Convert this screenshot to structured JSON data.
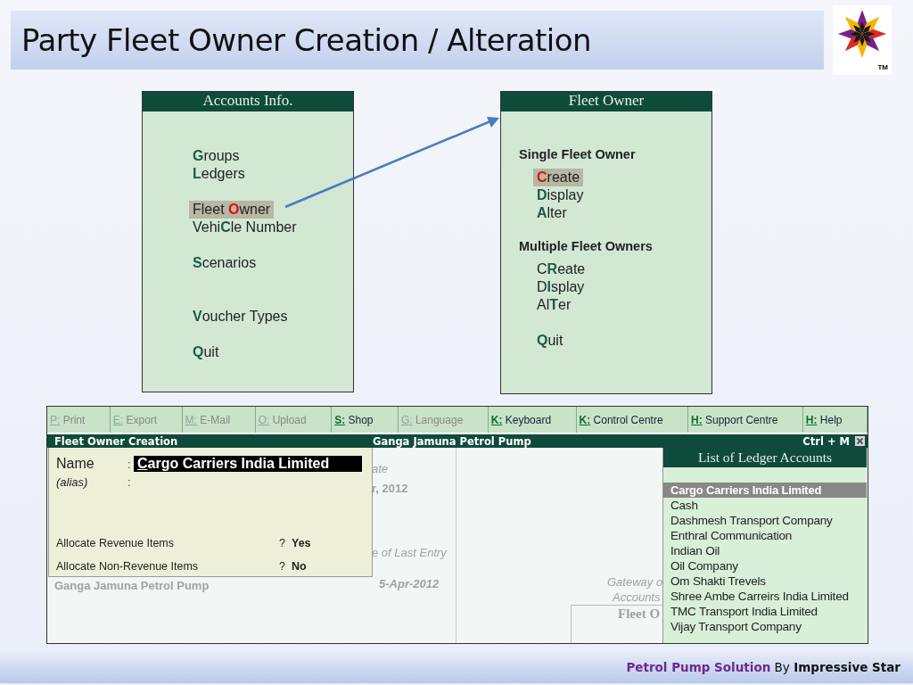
{
  "slide": {
    "title": "Party Fleet Owner Creation / Alteration",
    "logo_mark": "TM",
    "footer": "**Petrol Pump Solution** By **Impressive Star**"
  },
  "accounts_menu": {
    "title": "Accounts Info.",
    "groups": [
      {
        "items": [
          {
            "label": "**G**roups",
            "selected": false
          },
          {
            "label": "**L**edgers",
            "selected": false
          }
        ]
      },
      {
        "items": [
          {
            "label": "Fleet **O**wner",
            "selected": true
          },
          {
            "label": "Vehi**C**le Number",
            "selected": false
          }
        ]
      },
      {
        "items": [
          {
            "label": "**S**cenarios",
            "selected": false
          }
        ]
      },
      {
        "items": [
          {
            "label": "**V**oucher Types",
            "selected": false
          }
        ]
      },
      {
        "items": [
          {
            "label": "**Q**uit",
            "selected": false
          }
        ]
      }
    ]
  },
  "fleet_owner_menu": {
    "title": "Fleet Owner",
    "sections": [
      {
        "heading": "Single Fleet Owner",
        "items": [
          {
            "label": "**C**reate",
            "selected": true
          },
          {
            "label": "**D**isplay",
            "selected": false
          },
          {
            "label": "**A**lter",
            "selected": false
          }
        ]
      },
      {
        "heading": "Multiple Fleet Owners",
        "items": [
          {
            "label": "C**R**eate",
            "selected": false
          },
          {
            "label": "D**I**splay",
            "selected": false
          },
          {
            "label": "Al**T**er",
            "selected": false
          }
        ]
      },
      {
        "items": [
          {
            "label": "**Q**uit",
            "selected": false
          }
        ]
      }
    ]
  },
  "tally": {
    "toolbar": [
      {
        "key": "P:",
        "label": "Print",
        "disabled": true
      },
      {
        "key": "E:",
        "label": "Export",
        "disabled": true
      },
      {
        "key": "M:",
        "label": "E-Mail",
        "disabled": true
      },
      {
        "key": "O:",
        "label": "Upload",
        "disabled": true
      },
      {
        "key": "S:",
        "label": "Shop",
        "disabled": false
      },
      {
        "key": "G:",
        "label": "Language",
        "disabled": true
      },
      {
        "key": "K:",
        "label": "Keyboard",
        "disabled": false
      },
      {
        "key": "K:",
        "label": "Control Centre",
        "disabled": false
      },
      {
        "key": "H:",
        "label": "Support Centre",
        "disabled": false
      },
      {
        "key": "H:",
        "label": "Help",
        "disabled": false
      }
    ],
    "title_bar": {
      "screen": "Fleet Owner Creation",
      "company": "Ganga Jamuna Petrol Pump",
      "shortcut": "Ctrl + M"
    },
    "background_texts": [
      {
        "text": "ate",
        "kind": "italic"
      },
      {
        "text": "r, 2012",
        "kind": "bold"
      },
      {
        "text": "e of Last Entry",
        "kind": "italic"
      },
      {
        "text": "Ganga Jamuna Petrol Pump",
        "kind": "bold"
      },
      {
        "text": "5-Apr-2012",
        "kind": "bold-italic"
      },
      {
        "text": "Gateway o",
        "kind": "italic"
      },
      {
        "text": "Accounts",
        "kind": "italic"
      },
      {
        "text": "Fleet O",
        "kind": "serif"
      }
    ],
    "form": {
      "name_label": "Name",
      "name_value": "Cargo Carriers India Limited",
      "alias_label": "(alias)",
      "colon": ":",
      "options": [
        {
          "label": "Allocate Revenue Items",
          "mark": "?",
          "value": "Yes"
        },
        {
          "label": "Allocate Non-Revenue Items",
          "mark": "?",
          "value": "No"
        }
      ]
    },
    "ledger_list": {
      "title": "List of Ledger Accounts",
      "items": [
        {
          "label": "Cargo Carriers India Limited",
          "selected": true
        },
        {
          "label": "Cash",
          "selected": false
        },
        {
          "label": "Dashmesh Transport Company",
          "selected": false
        },
        {
          "label": "Enthral  Communication",
          "selected": false
        },
        {
          "label": "Indian Oil",
          "selected": false
        },
        {
          "label": "Oil Company",
          "selected": false
        },
        {
          "label": "Om Shakti Trevels",
          "selected": false
        },
        {
          "label": "Shree Ambe Carreirs India Limited",
          "selected": false
        },
        {
          "label": "TMC Transport India Limited",
          "selected": false
        },
        {
          "label": "Vijay Transport Company",
          "selected": false
        }
      ]
    }
  }
}
